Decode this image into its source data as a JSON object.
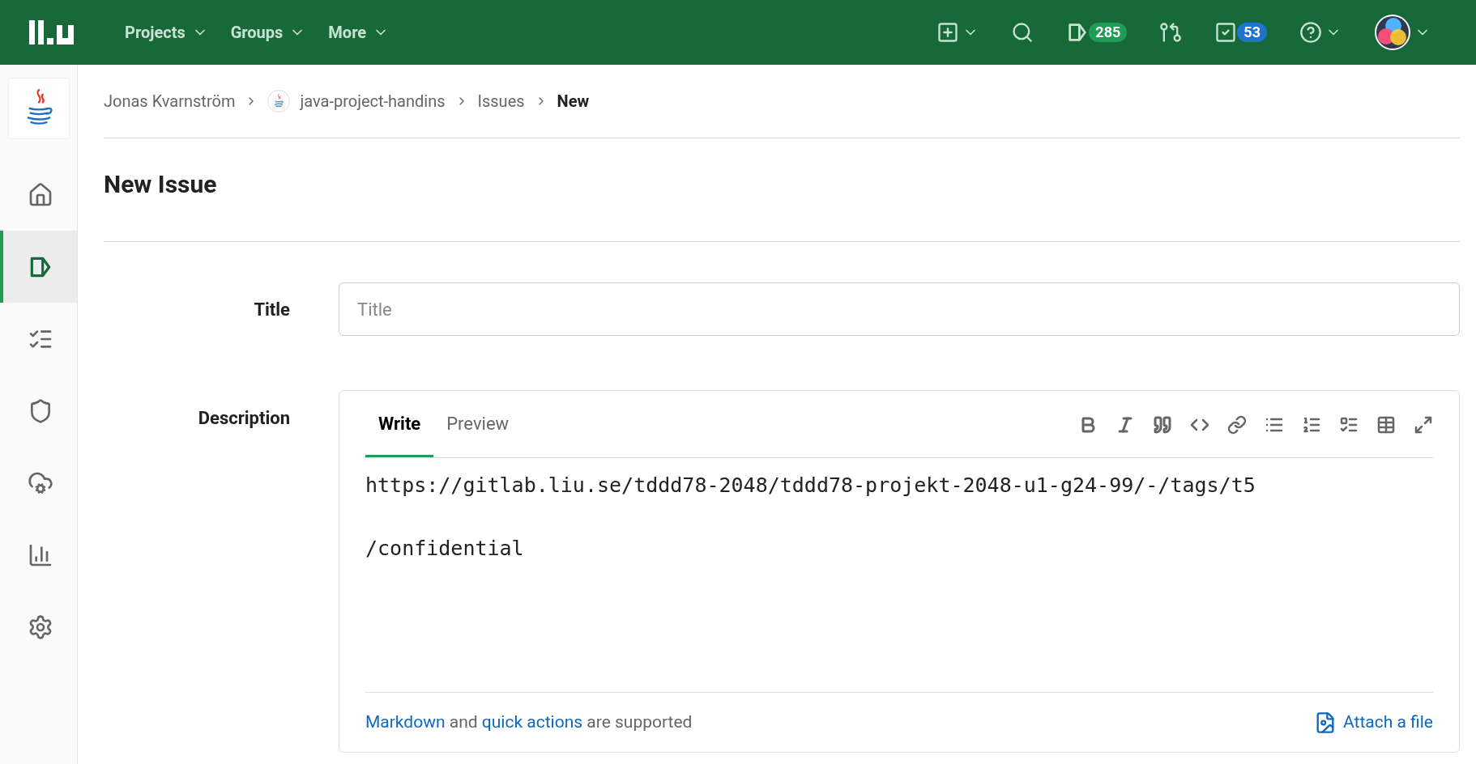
{
  "topbar": {
    "nav": [
      {
        "label": "Projects"
      },
      {
        "label": "Groups"
      },
      {
        "label": "More"
      }
    ],
    "actions": [
      {
        "kind": "new",
        "dropdown": true
      },
      {
        "kind": "search",
        "dropdown": false
      },
      {
        "kind": "issues",
        "count": "285",
        "color": "#1f9d55"
      },
      {
        "kind": "merge",
        "dropdown": false
      },
      {
        "kind": "todos",
        "count": "53",
        "color": "#1f75cb"
      },
      {
        "kind": "help",
        "dropdown": true
      },
      {
        "kind": "avatar",
        "dropdown": true
      }
    ]
  },
  "sidebar": {
    "items": [
      {
        "kind": "home",
        "selected": false
      },
      {
        "kind": "issues",
        "selected": true
      },
      {
        "kind": "list",
        "selected": false
      },
      {
        "kind": "security",
        "selected": false
      },
      {
        "kind": "deploy",
        "selected": false
      },
      {
        "kind": "analytics",
        "selected": false
      },
      {
        "kind": "settings",
        "selected": false
      }
    ]
  },
  "breadcrumb": [
    {
      "label": "Jonas Kvarnström",
      "current": false,
      "avatar": false
    },
    {
      "label": "java-project-handins",
      "current": false,
      "avatar": true
    },
    {
      "label": "Issues",
      "current": false,
      "avatar": false
    },
    {
      "label": "New",
      "current": true,
      "avatar": false
    }
  ],
  "page_title": "New Issue",
  "form": {
    "title_label": "Title",
    "title_placeholder": "Title",
    "description_label": "Description",
    "tabs": [
      {
        "label": "Write",
        "selected": true
      },
      {
        "label": "Preview",
        "selected": false
      }
    ],
    "description_value": "https://gitlab.liu.se/tddd78-2048/tddd78-projekt-2048-u1-g24-99/-/tags/t5\n\n/confidential",
    "hint": [
      {
        "kind": "link",
        "text": "Markdown"
      },
      {
        "kind": "text",
        "text": " and "
      },
      {
        "kind": "link",
        "text": "quick actions"
      },
      {
        "kind": "text",
        "text": " are supported"
      }
    ],
    "attach": "Attach a file"
  }
}
